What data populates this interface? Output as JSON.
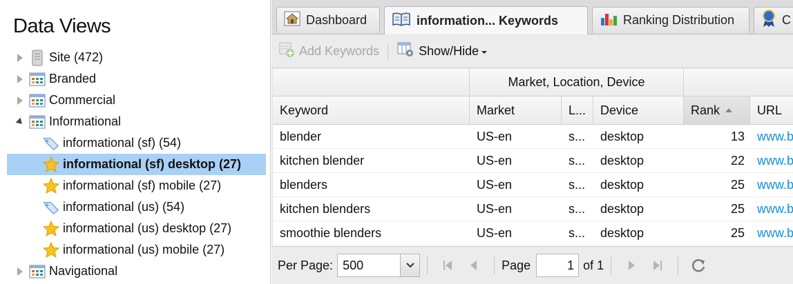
{
  "sidebar": {
    "title": "Data Views",
    "items": [
      {
        "label": "Site (472)",
        "icon": "server-icon",
        "expander": "collapsed",
        "indent": 0
      },
      {
        "label": "Branded",
        "icon": "grid-view-icon",
        "expander": "collapsed",
        "indent": 0
      },
      {
        "label": "Commercial",
        "icon": "grid-view-icon",
        "expander": "collapsed",
        "indent": 0
      },
      {
        "label": "Informational",
        "icon": "grid-view-icon",
        "expander": "expanded",
        "indent": 0
      },
      {
        "label": "informational (sf) (54)",
        "icon": "tag-icon",
        "expander": "none",
        "indent": 1
      },
      {
        "label": "informational (sf) desktop (27)",
        "icon": "star-icon",
        "expander": "none",
        "indent": 1,
        "selected": true
      },
      {
        "label": "informational (sf) mobile (27)",
        "icon": "star-icon",
        "expander": "none",
        "indent": 1
      },
      {
        "label": "informational (us) (54)",
        "icon": "tag-icon",
        "expander": "none",
        "indent": 1
      },
      {
        "label": "informational (us) desktop (27)",
        "icon": "star-icon",
        "expander": "none",
        "indent": 1
      },
      {
        "label": "informational (us) mobile (27)",
        "icon": "star-icon",
        "expander": "none",
        "indent": 1
      },
      {
        "label": "Navigational",
        "icon": "grid-view-icon",
        "expander": "collapsed",
        "indent": 0
      }
    ]
  },
  "tabs": [
    {
      "label": "Dashboard",
      "icon": "house-icon"
    },
    {
      "label": "information... Keywords",
      "icon": "book-icon",
      "active": true
    },
    {
      "label": "Ranking Distribution",
      "icon": "bar-chart-icon"
    },
    {
      "label": "C",
      "icon": "award-ribbon-icon"
    }
  ],
  "toolbar": {
    "add_keywords": "Add Keywords",
    "show_hide": "Show/Hide"
  },
  "grid": {
    "group_header": "Market, Location, Device",
    "columns": [
      "Keyword",
      "Market",
      "L...",
      "Device",
      "Rank",
      "URL"
    ],
    "rows": [
      {
        "keyword": "blender",
        "market": "US-en",
        "location": "s...",
        "device": "desktop",
        "rank": "13",
        "url": "www.b"
      },
      {
        "keyword": "kitchen blender",
        "market": "US-en",
        "location": "s...",
        "device": "desktop",
        "rank": "22",
        "url": "www.b"
      },
      {
        "keyword": "blenders",
        "market": "US-en",
        "location": "s...",
        "device": "desktop",
        "rank": "25",
        "url": "www.b"
      },
      {
        "keyword": "kitchen blenders",
        "market": "US-en",
        "location": "s...",
        "device": "desktop",
        "rank": "25",
        "url": "www.b"
      },
      {
        "keyword": "smoothie blenders",
        "market": "US-en",
        "location": "s...",
        "device": "desktop",
        "rank": "25",
        "url": "www.b"
      }
    ]
  },
  "pager": {
    "per_page_label": "Per Page:",
    "per_page_value": "500",
    "page_label": "Page",
    "page_value": "1",
    "of_label": "of 1"
  },
  "colors": {
    "selection": "#a9d0f5",
    "link": "#1a8fd8"
  }
}
